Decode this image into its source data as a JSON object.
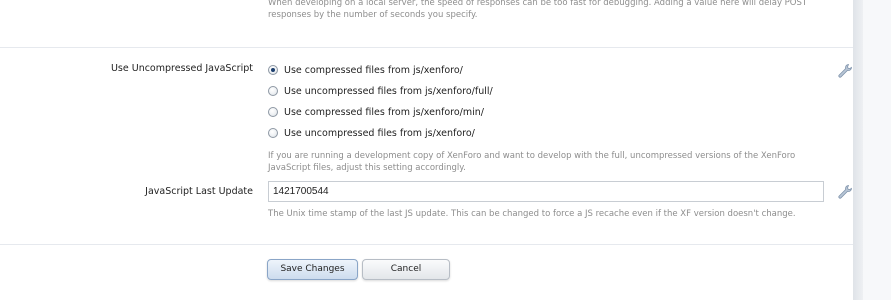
{
  "top_hint": "When developing on a local server, the speed of responses can be too fast for debugging. Adding a value here will delay POST responses by the number of seconds you specify.",
  "uncompressed_js": {
    "label": "Use Uncompressed JavaScript",
    "options": [
      {
        "label": "Use compressed files from js/xenforo/",
        "checked": true
      },
      {
        "label": "Use uncompressed files from js/xenforo/full/",
        "checked": false
      },
      {
        "label": "Use compressed files from js/xenforo/min/",
        "checked": false
      },
      {
        "label": "Use uncompressed files from js/xenforo/",
        "checked": false
      }
    ],
    "hint": "If you are running a development copy of XenForo and want to develop with the full, uncompressed versions of the XenForo JavaScript files, adjust this setting accordingly."
  },
  "js_last_update": {
    "label": "JavaScript Last Update",
    "value": "1421700544",
    "hint": "The Unix time stamp of the last JS update. This can be changed to force a JS recache even if the XF version doesn't change."
  },
  "buttons": {
    "save": "Save Changes",
    "cancel": "Cancel"
  }
}
